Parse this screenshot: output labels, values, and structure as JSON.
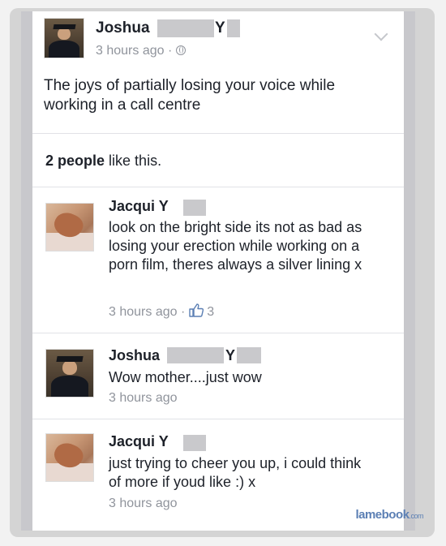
{
  "post": {
    "author_first": "Joshua",
    "author_initial": "Y",
    "timestamp": "3 hours ago",
    "separator": "·",
    "privacy_icon": "globe-icon",
    "menu_icon": "chevron-down-icon",
    "text": "The joys of partially losing your voice while working in a call centre",
    "likes_count": "2 people",
    "likes_suffix": "like this."
  },
  "comments": [
    {
      "name": "Jacqui Y",
      "text": "look on the bright side its not as bad as losing your erection while working on a porn film, theres always a silver lining x",
      "timestamp": "3 hours ago",
      "separator": "·",
      "like_icon": "thumbs-up-icon",
      "like_count": "3"
    },
    {
      "name_first": "Joshua",
      "name_initial": "Y",
      "text": "Wow mother....just wow",
      "timestamp": "3 hours ago"
    },
    {
      "name": "Jacqui Y",
      "text": "just trying to cheer you up, i could think of more if youd like :) x",
      "timestamp": "3 hours ago"
    }
  ],
  "watermark": {
    "brand": "lamebook",
    "tld": ".com"
  },
  "colors": {
    "link": "#1d2129",
    "meta": "#90949c",
    "watermark": "#5b7fb4",
    "frame": "#c8c8cc"
  }
}
